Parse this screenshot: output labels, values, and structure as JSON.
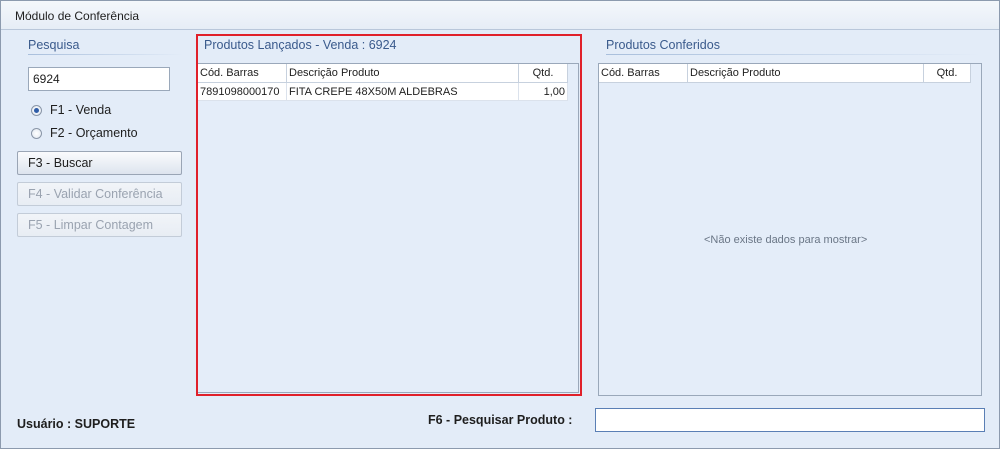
{
  "window": {
    "title": "Módulo de Conferência"
  },
  "search_panel": {
    "title": "Pesquisa",
    "input_value": "6924",
    "radios": [
      {
        "label": "F1 - Venda",
        "checked": true
      },
      {
        "label": "F2 - Orçamento",
        "checked": false
      }
    ],
    "buttons": [
      {
        "label": "F3 - Buscar",
        "enabled": true
      },
      {
        "label": "F4 - Validar Conferência",
        "enabled": false
      },
      {
        "label": "F5 - Limpar Contagem",
        "enabled": false
      }
    ]
  },
  "launched_panel": {
    "title": "Produtos Lançados - Venda : 6924",
    "columns": [
      "Cód. Barras",
      "Descrição Produto",
      "Qtd."
    ],
    "rows": [
      {
        "barcode": "7891098000170",
        "description": "FITA CREPE 48X50M ALDEBRAS",
        "qty": "1,00"
      }
    ]
  },
  "checked_panel": {
    "title": "Produtos Conferidos",
    "columns": [
      "Cód. Barras",
      "Descrição Produto",
      "Qtd."
    ],
    "empty_message": "<Não existe dados para mostrar>"
  },
  "footer": {
    "user_label": "Usuário : SUPORTE",
    "search_product_label": "F6 - Pesquisar Produto :",
    "search_product_value": ""
  },
  "colors": {
    "highlight_border": "#e0202a",
    "section_title": "#3a5a8c"
  }
}
